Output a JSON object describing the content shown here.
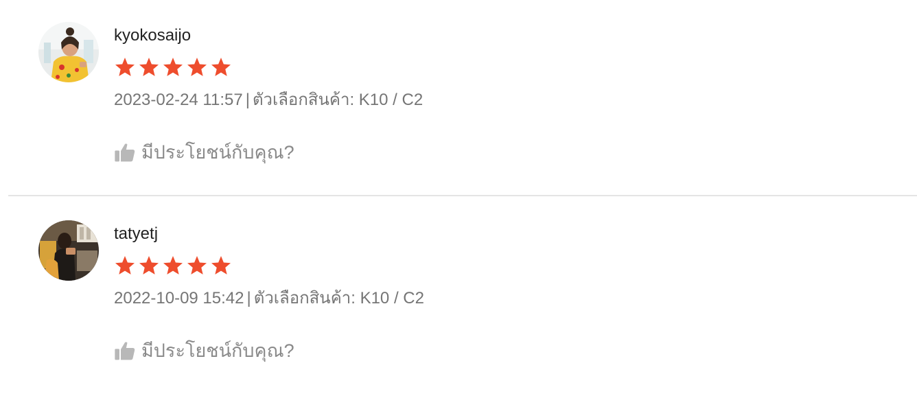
{
  "reviews": [
    {
      "username": "kyokosaijo",
      "rating": 5,
      "date": "2023-02-24 11:57",
      "separator": "|",
      "variation": "ตัวเลือกสินค้า: K10 / C2",
      "helpful_label": "มีประโยชน์กับคุณ?"
    },
    {
      "username": "tatyetj",
      "rating": 5,
      "date": "2022-10-09 15:42",
      "separator": "|",
      "variation": "ตัวเลือกสินค้า: K10 / C2",
      "helpful_label": "มีประโยชน์กับคุณ?"
    }
  ],
  "colors": {
    "star": "#ee4d2d",
    "username": "#222222",
    "meta": "#757575",
    "helpful": "#8a8a8a",
    "thumb": "#b8b8b8",
    "divider": "#e4e4e4"
  },
  "icons": {
    "star": "star-icon",
    "helpful": "thumbs-up-icon"
  }
}
